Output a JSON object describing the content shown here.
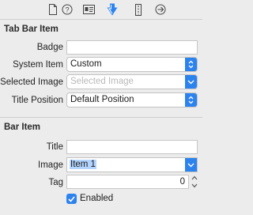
{
  "toolbar": {
    "icons": [
      "file-icon",
      "help-icon",
      "identity-icon",
      "attributes-icon",
      "size-icon",
      "connections-icon"
    ],
    "selected": "attributes-icon",
    "accent": "#2d83ee"
  },
  "tab_bar_item": {
    "title": "Tab Bar Item",
    "badge_label": "Badge",
    "badge_value": "",
    "system_item_label": "System Item",
    "system_item_value": "Custom",
    "selected_image_label": "Selected Image",
    "selected_image_placeholder": "Selected Image",
    "title_position_label": "Title Position",
    "title_position_value": "Default Position"
  },
  "bar_item": {
    "title": "Bar Item",
    "title_label": "Title",
    "title_value": "",
    "image_label": "Image",
    "image_value": "Item 1",
    "tag_label": "Tag",
    "tag_value": "0",
    "enabled_label": "Enabled",
    "enabled_checked": true
  }
}
